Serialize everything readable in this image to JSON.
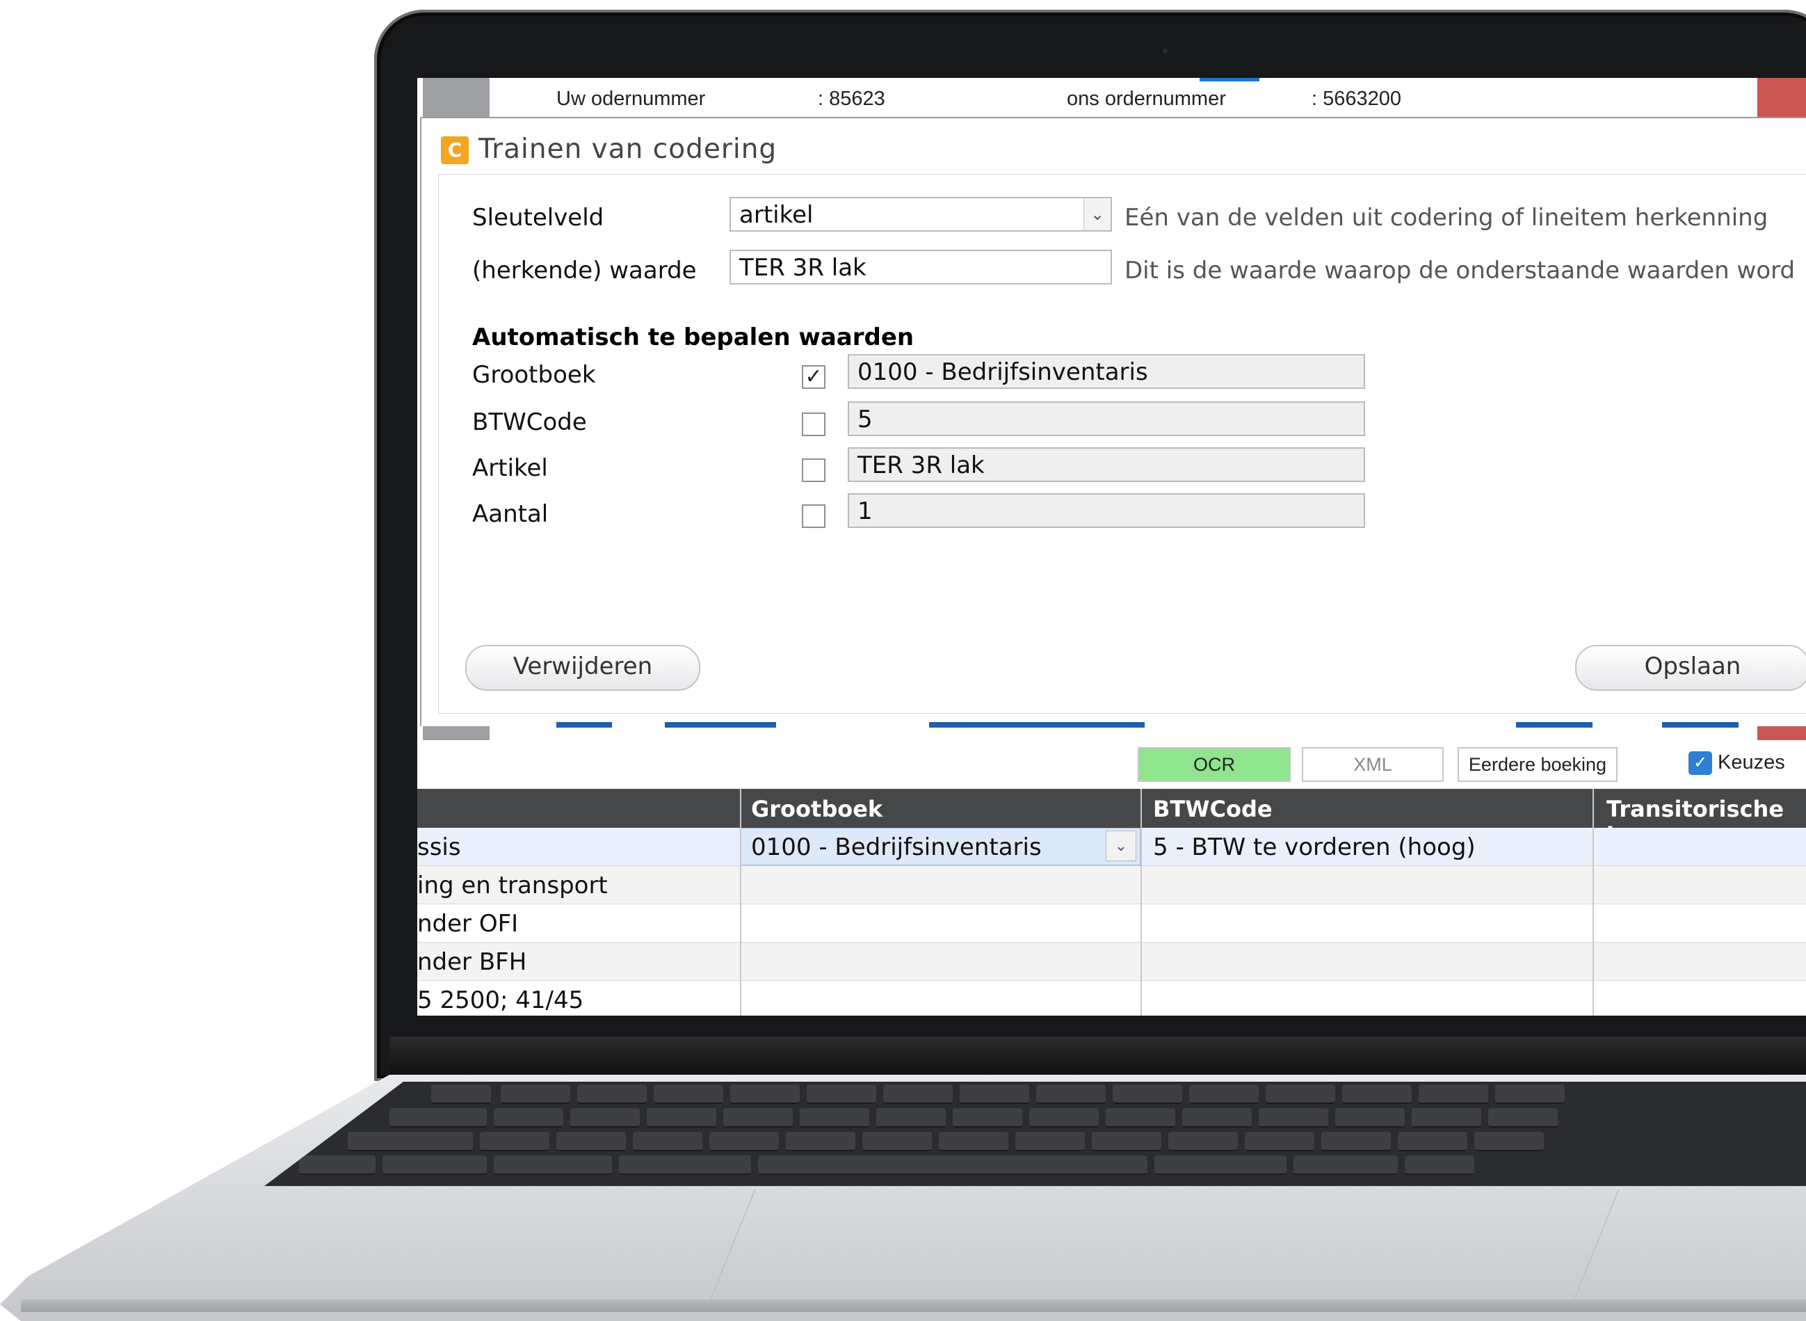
{
  "background_app": {
    "order_label_yours": "Uw odernummer",
    "order_value_yours": ": 85623",
    "order_label_ours": "ons ordernummer",
    "order_value_ours": ": 5663200"
  },
  "dialog": {
    "icon_letter": "C",
    "title": "Trainen van codering",
    "key_field": {
      "label": "Sleutelveld",
      "value": "artikel",
      "hint": "Eén van de velden uit codering of lineitem herkenning"
    },
    "recognized_value": {
      "label": "(herkende) waarde",
      "value": "TER 3R lak",
      "hint": "Dit is de waarde waarop de onderstaande waarden word"
    },
    "section_title": "Automatisch te bepalen waarden",
    "rows": [
      {
        "label": "Grootboek",
        "checked": true,
        "value": "0100 - Bedrijfsinventaris"
      },
      {
        "label": "BTWCode",
        "checked": false,
        "value": "5"
      },
      {
        "label": "Artikel",
        "checked": false,
        "value": "TER 3R lak"
      },
      {
        "label": "Aantal",
        "checked": false,
        "value": "1"
      }
    ],
    "delete_button": "Verwijderen",
    "save_button": "Opslaan"
  },
  "tabs": {
    "ocr": "OCR",
    "xml": "XML",
    "previous": "Eerdere boeking",
    "keuzes": "Keuzes"
  },
  "colors": {
    "ocr_tab": "#8ee58e",
    "header": "#454749",
    "selection": "#dce9f8",
    "accent": "#2d7fd4"
  },
  "grid": {
    "headers": [
      "Grootboek",
      "BTWCode",
      "Transitorische b"
    ],
    "rows": [
      {
        "desc": "ssis",
        "grootboek": "0100 - Bedrijfsinventaris",
        "btw": "5 - BTW te vorderen (hoog)"
      },
      {
        "desc": "ing en transport",
        "grootboek": "",
        "btw": ""
      },
      {
        "desc": "nder OFI",
        "grootboek": "",
        "btw": ""
      },
      {
        "desc": "nder BFH",
        "grootboek": "",
        "btw": ""
      },
      {
        "desc": "5 2500; 41/45",
        "grootboek": "",
        "btw": ""
      }
    ]
  }
}
